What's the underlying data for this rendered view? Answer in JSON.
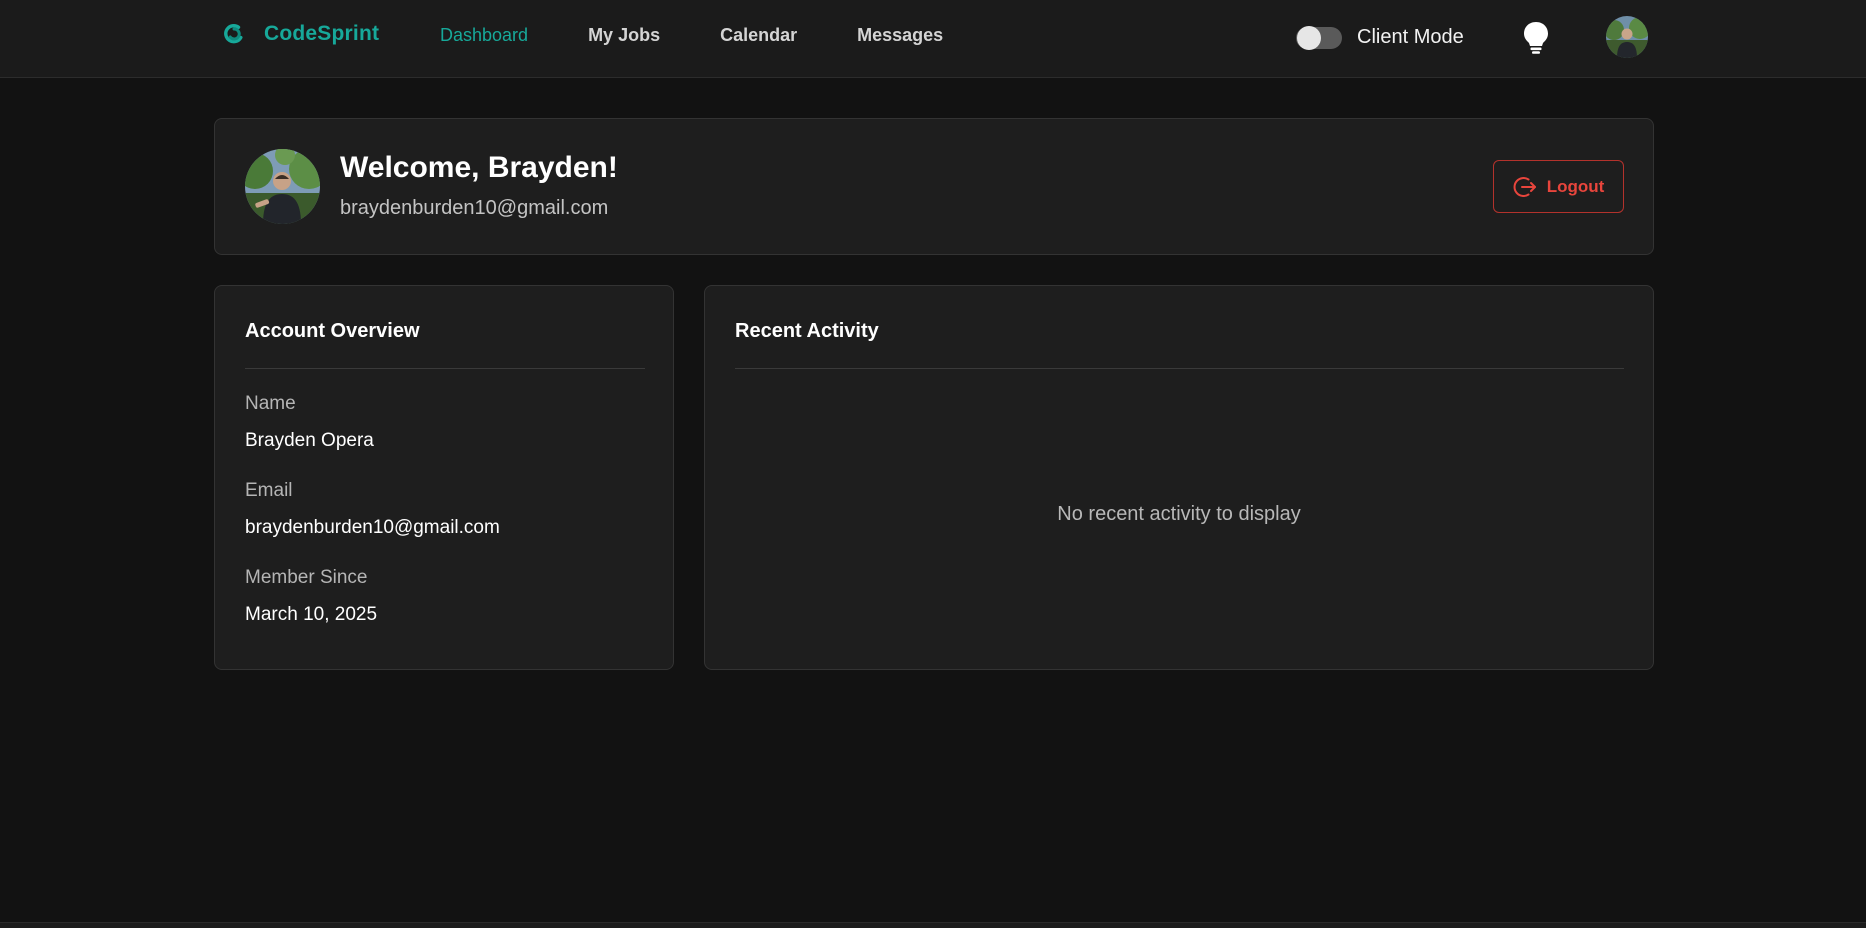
{
  "navbar": {
    "brand": "CodeSprint",
    "links": [
      {
        "label": "Dashboard",
        "active": true
      },
      {
        "label": "My Jobs",
        "active": false
      },
      {
        "label": "Calendar",
        "active": false
      },
      {
        "label": "Messages",
        "active": false
      }
    ],
    "mode_toggle_label": "Client Mode",
    "mode_toggle_on": false,
    "theme_icon": "lightbulb-icon"
  },
  "welcome": {
    "title": "Welcome, Brayden!",
    "email": "braydenburden10@gmail.com",
    "logout_label": "Logout"
  },
  "account_overview": {
    "title": "Account Overview",
    "fields": [
      {
        "label": "Name",
        "value": "Brayden Opera"
      },
      {
        "label": "Email",
        "value": "braydenburden10@gmail.com"
      },
      {
        "label": "Member Since",
        "value": "March 10, 2025"
      }
    ]
  },
  "recent_activity": {
    "title": "Recent Activity",
    "empty_message": "No recent activity to display"
  },
  "colors": {
    "accent": "#17a99a",
    "danger": "#e8453c",
    "background": "#121212",
    "card": "#1e1e1e"
  }
}
